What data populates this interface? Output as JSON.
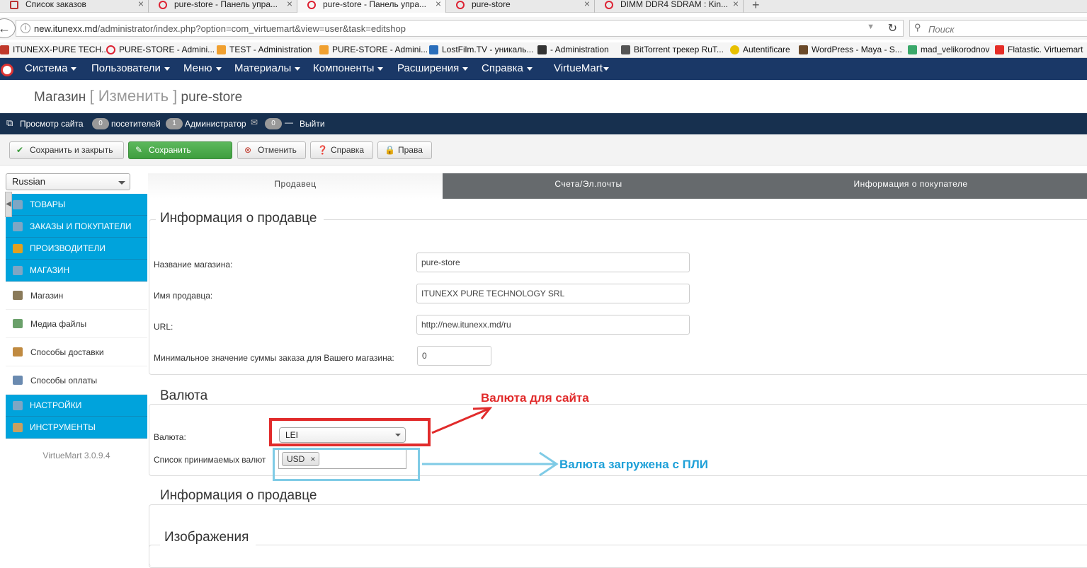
{
  "browser": {
    "tabs": [
      {
        "label": "Список заказов",
        "active": false
      },
      {
        "label": "pure-store - Панель упра...",
        "active": false
      },
      {
        "label": "pure-store - Панель упра...",
        "active": true
      },
      {
        "label": "pure-store",
        "active": false
      },
      {
        "label": "DIMM DDR4 SDRAM : Kin...",
        "active": false
      }
    ],
    "new_tab": "+",
    "url_host": "new.itunexx.md",
    "url_path": "/administrator/index.php?option=com_virtuemart&view=user&task=editshop",
    "search_placeholder": "Поиск",
    "bookmarks": [
      "ITUNEXX-PURE TECH...",
      "PURE-STORE - Admini...",
      "TEST - Administration",
      "PURE-STORE - Admini...",
      "LostFilm.TV - уникаль...",
      "- Administration",
      "BitTorrent трекер RuT...",
      "Autentificare",
      "WordPress - Maya - S...",
      "mad_velikorodnov",
      "Flatastic. Virtuemart"
    ]
  },
  "topmenu": {
    "items": [
      "Система",
      "Пользователи",
      "Меню",
      "Материалы",
      "Компоненты",
      "Расширения",
      "Справка",
      "VirtueMart"
    ]
  },
  "header": {
    "title_main": "Магазин",
    "title_action": "[ Изменить ]",
    "title_name": "pure-store"
  },
  "statusbar": {
    "view_site": "Просмотр сайта",
    "visitors_count": "0",
    "visitors_label": "посетителей",
    "admin_count": "1",
    "admin_label": "Администратор",
    "messages_count": "0",
    "logout": "Выйти"
  },
  "toolbar": {
    "save_close": "Сохранить и закрыть",
    "save": "Сохранить",
    "cancel": "Отменить",
    "help": "Справка",
    "rights": "Права"
  },
  "sidebar": {
    "language": "Russian",
    "sections": [
      {
        "label": "ТОВАРЫ"
      },
      {
        "label": "ЗАКАЗЫ И ПОКУПАТЕЛИ"
      },
      {
        "label": "ПРОИЗВОДИТЕЛИ"
      },
      {
        "label": "МАГАЗИН"
      }
    ],
    "shop_items": [
      "Магазин",
      "Медиа файлы",
      "Способы доставки",
      "Способы оплаты"
    ],
    "bottom_sections": [
      {
        "label": "НАСТРОЙКИ"
      },
      {
        "label": "ИНСТРУМЕНТЫ"
      }
    ],
    "version": "VirtueMart 3.0.9.4"
  },
  "content_tabs": [
    "Продавец",
    "Счета/Эл.почты",
    "Информация о покупателе"
  ],
  "vendor_info": {
    "legend": "Информация о продавце",
    "store_name_label": "Название магазина:",
    "store_name_value": "pure-store",
    "vendor_name_label": "Имя продавца:",
    "vendor_name_value": "ITUNEXX PURE TECHNOLOGY SRL",
    "url_label": "URL:",
    "url_value": "http://new.itunexx.md/ru",
    "min_order_label": "Минимальное значение суммы заказа для Вашего магазина:",
    "min_order_value": "0"
  },
  "currency": {
    "legend": "Валюта",
    "currency_label": "Валюта:",
    "currency_value": "LEI",
    "accepted_label": "Список принимаемых валют",
    "accepted_tag": "USD",
    "tag_remove": "×"
  },
  "vendor_info_2": {
    "legend": "Информация о продавце"
  },
  "images": {
    "legend": "Изображения"
  },
  "annotations": {
    "red_text": "Валюта для сайта",
    "blue_text": "Валюта загружена с ПЛИ",
    "red_color": "#e12b2b",
    "blue_color": "#7fcbe6"
  }
}
